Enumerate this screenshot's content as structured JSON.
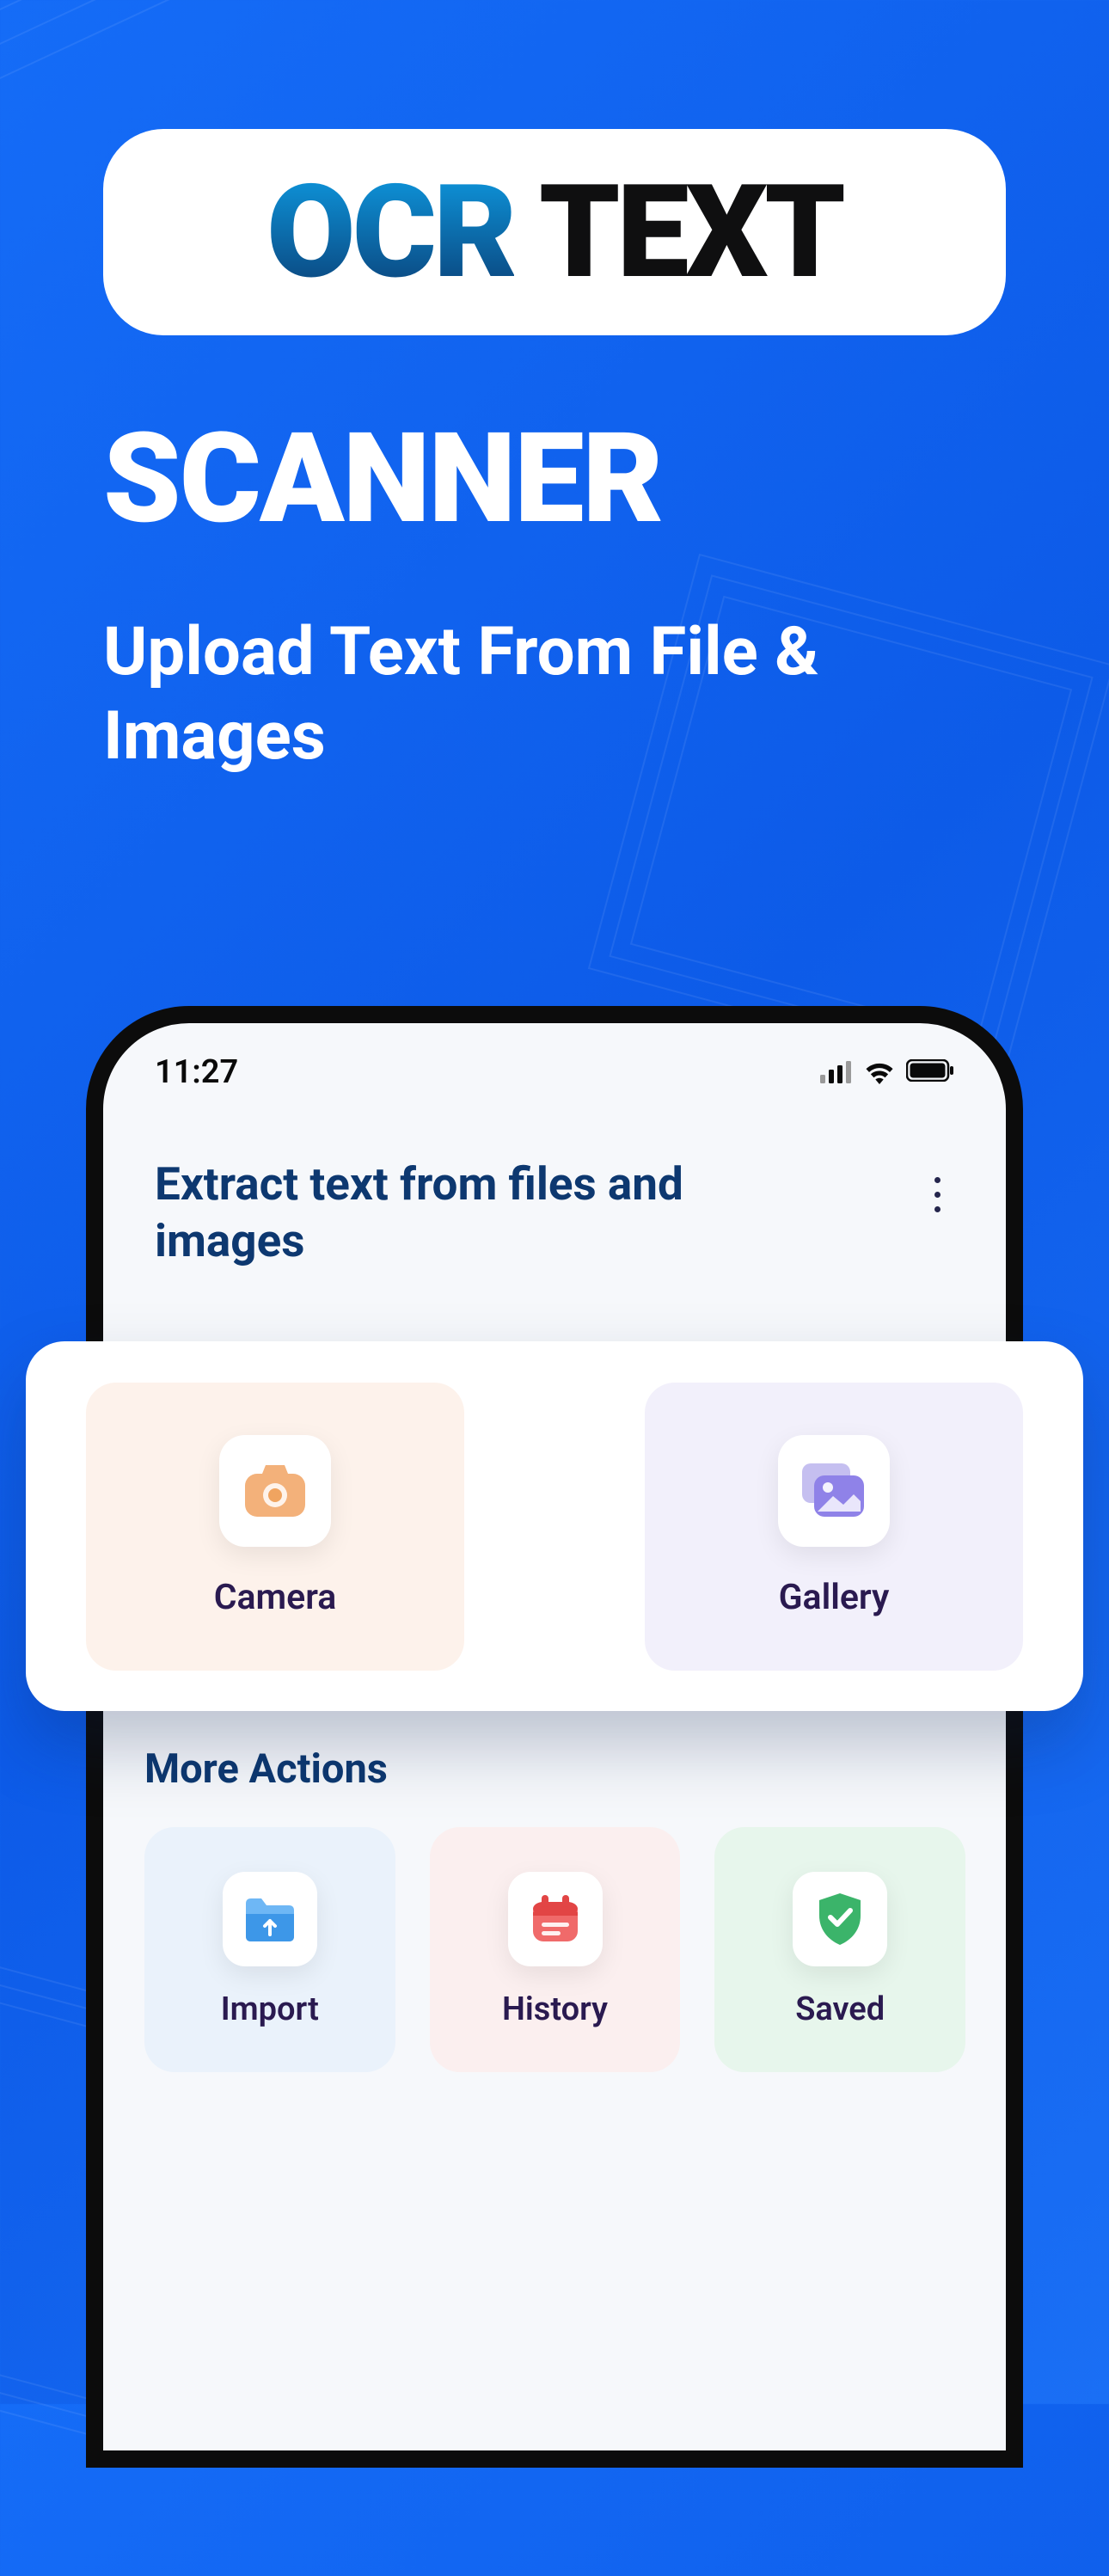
{
  "promo": {
    "pill_ocr": "OCR",
    "pill_text": " TEXT",
    "scanner": "SCANNER",
    "subtitle": "Upload Text From File & Images"
  },
  "phone": {
    "status": {
      "time": "11:27"
    },
    "header": {
      "title": "Extract text from files and images"
    },
    "primary_actions": {
      "camera_label": "Camera",
      "gallery_label": "Gallery"
    },
    "more_actions": {
      "header": "More Actions",
      "import_label": "Import",
      "history_label": "History",
      "saved_label": "Saved"
    }
  }
}
